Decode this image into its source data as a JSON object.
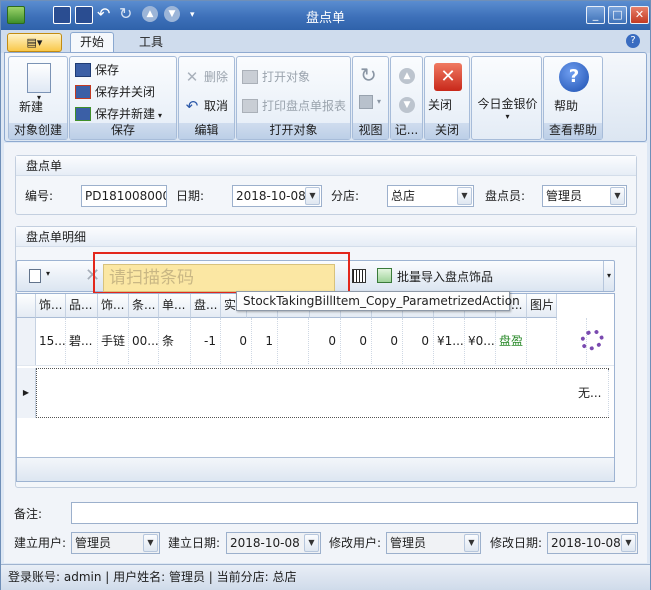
{
  "window": {
    "title": "盘点单"
  },
  "tabs": {
    "app_menu": "▤▾",
    "home": "开始",
    "tools": "工具"
  },
  "ribbon": {
    "new_label": "新建",
    "save": "保存",
    "save_close": "保存并关闭",
    "save_new": "保存并新建",
    "delete": "删除",
    "cancel": "取消",
    "open_object": "打开对象",
    "print_report": "打印盘点单报表",
    "close": "关闭",
    "gold_price": "今日金银价",
    "help": "帮助",
    "groups": {
      "create": "对象创建",
      "save": "保存",
      "edit": "编辑",
      "open": "打开对象",
      "view": "视图",
      "record": "记...",
      "close": "关闭",
      "help": "查看帮助"
    }
  },
  "header_section": {
    "title": "盘点单",
    "number_label": "编号:",
    "number_value": "PD181008000",
    "date_label": "日期:",
    "date_value": "2018-10-08",
    "branch_label": "分店:",
    "branch_value": "总店",
    "clerk_label": "盘点员:",
    "clerk_value": "管理员"
  },
  "detail_section": {
    "title": "盘点单明细",
    "scan_placeholder": "请扫描条码",
    "bulk_import": "批量导入盘点饰品",
    "tooltip": "StockTakingBillItem_Copy_ParametrizedAction"
  },
  "grid": {
    "headers": [
      "饰...",
      "品...",
      "饰...",
      "条...",
      "单...",
      "盘...",
      "实",
      "",
      "",
      "",
      "",
      "",
      "",
      "",
      "盘...",
      "备...",
      "图片"
    ],
    "row1": [
      "15...",
      "碧...",
      "手链",
      "00...",
      "条",
      "-1",
      "0",
      "1",
      "",
      "0",
      "0",
      "0",
      "0",
      "¥1...",
      "¥0...",
      "盘盈",
      "",
      ""
    ],
    "row2_last": "无..."
  },
  "footer": {
    "remark_label": "备注:",
    "create_user_label": "建立用户:",
    "create_user_value": "管理员",
    "create_date_label": "建立日期:",
    "create_date_value": "2018-10-08",
    "modify_user_label": "修改用户:",
    "modify_user_value": "管理员",
    "modify_date_label": "修改日期:",
    "modify_date_value": "2018-10-08"
  },
  "status": {
    "text": "登录账号: admin  |  用户姓名: 管理员  |  当前分店: 总店"
  },
  "colors": {
    "surplus": "#2a8a2a",
    "accent": "#3d70b9",
    "highlight_box": "#e3271c"
  }
}
